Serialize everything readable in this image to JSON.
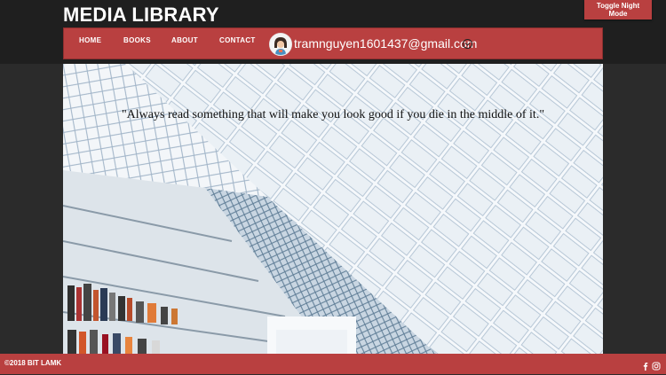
{
  "header": {
    "brand": "MEDIA LIBRARY",
    "night_mode_label": "Toggle Night Mode"
  },
  "nav": {
    "items": [
      {
        "label": "HOME"
      },
      {
        "label": "BOOKS"
      },
      {
        "label": "ABOUT"
      },
      {
        "label": "CONTACT"
      }
    ],
    "user": {
      "email": "tramnguyen1601437@gmail.com",
      "avatar_icon": "avatar-illustration",
      "dropdown_icon": "chevron-circle-icon"
    }
  },
  "hero": {
    "quote": "\"Always read something that will make you look good if you die in the middle of it.\"",
    "background": "library-architecture-photo"
  },
  "footer": {
    "copyright": "©2018 BIT LAMK",
    "social_icons": [
      "facebook-icon",
      "instagram-icon"
    ]
  },
  "colors": {
    "accent": "#b94040",
    "topbar": "#1f1f1f",
    "page": "#2b2b2b"
  }
}
